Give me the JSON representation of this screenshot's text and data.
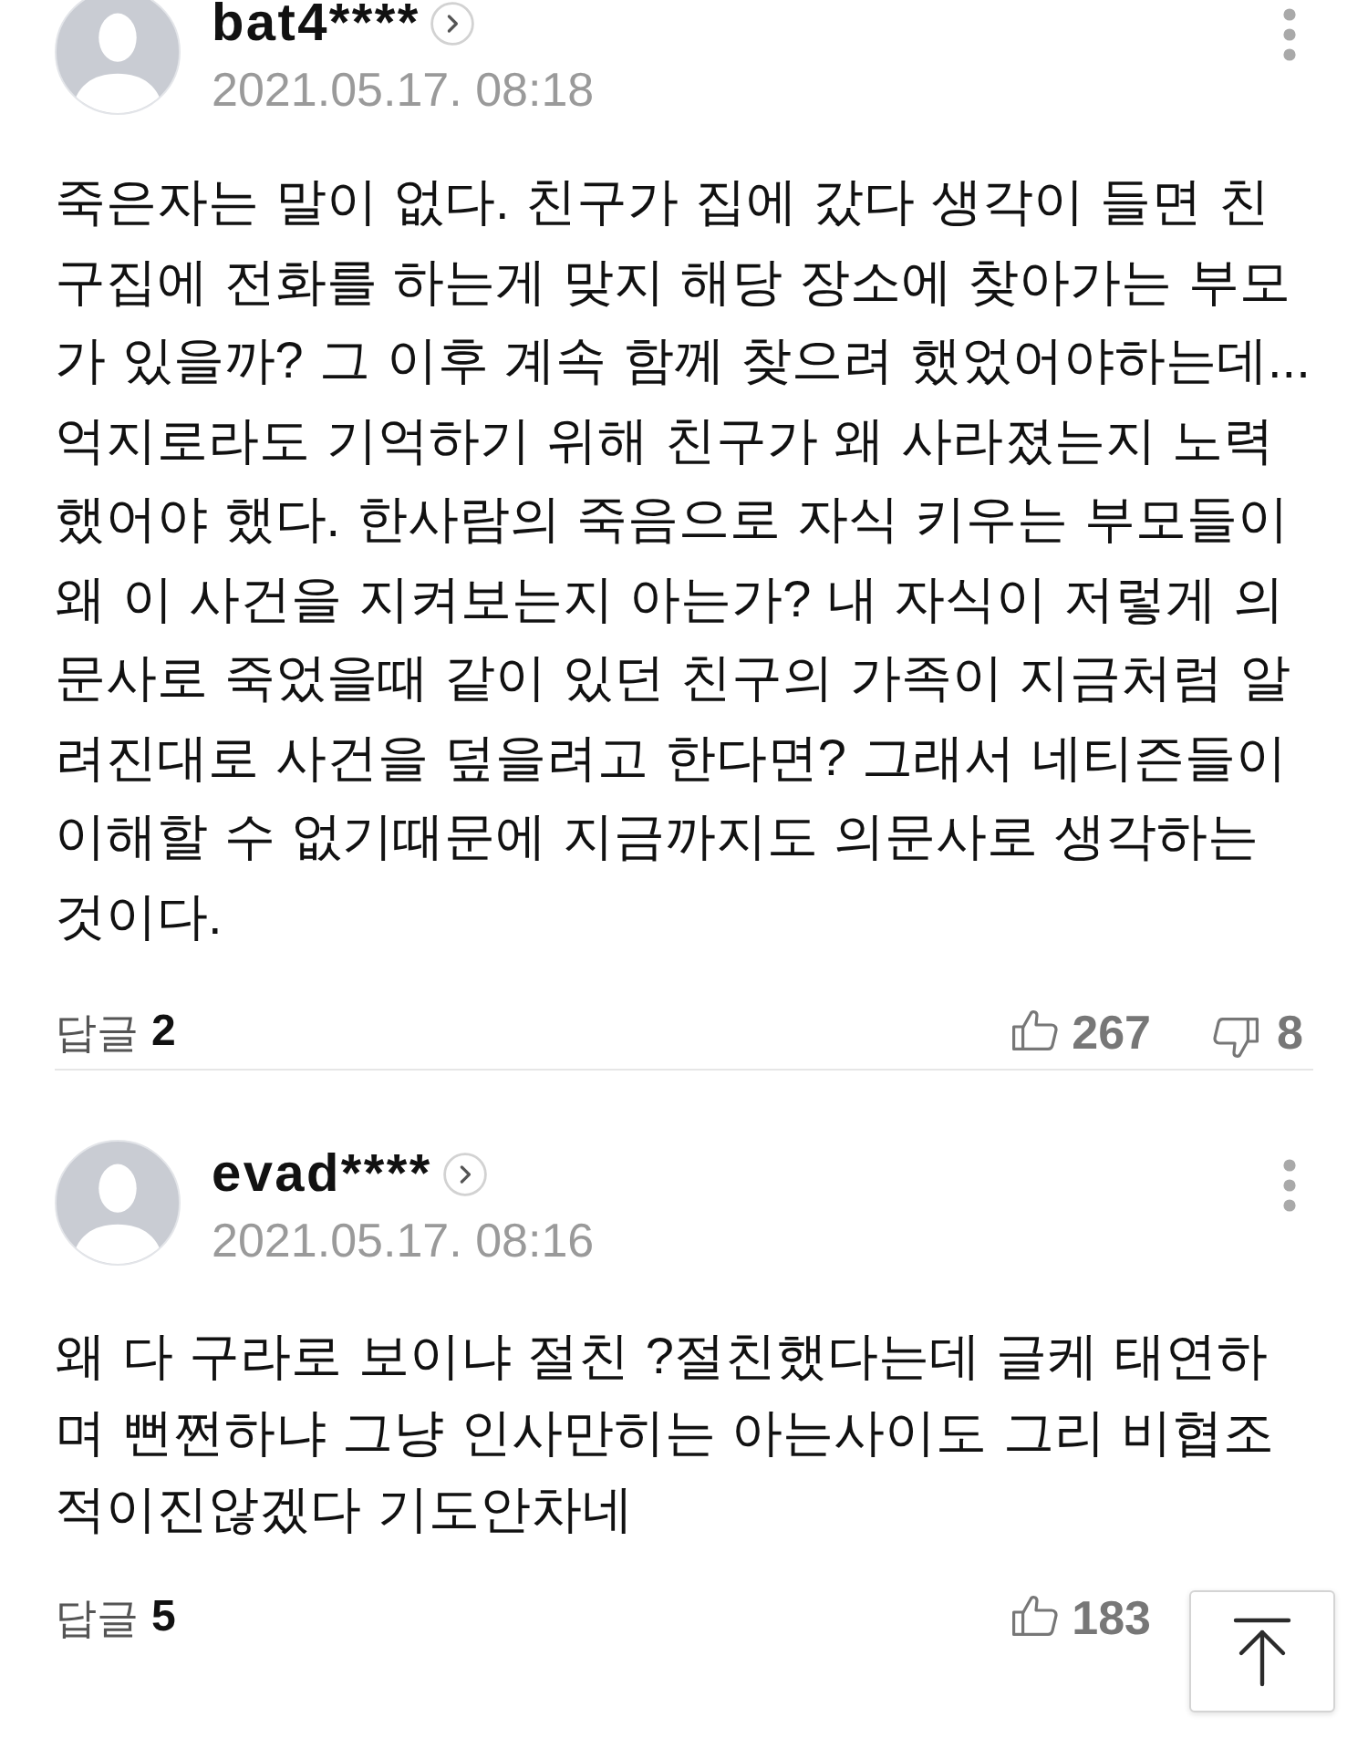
{
  "comments": [
    {
      "author": "bat4****",
      "date": "2021.05.17. 08:18",
      "text": "죽은자는 말이 없다. 친구가 집에 갔다 생각이 들면 친구집에 전화를 하는게 맞지 해당 장소에 찾아가는 부모가 있을까? 그 이후 계속 함께 찾으려 했었어야하는데...억지로라도 기억하기 위해 친구가 왜 사라졌는지 노력했어야 했다. 한사람의 죽음으로 자식 키우는 부모들이 왜 이 사건을 지켜보는지 아는가? 내 자식이 저렇게 의문사로 죽었을때 같이 있던 친구의 가족이 지금처럼 알려진대로 사건을 덮을려고 한다면? 그래서 네티즌들이 이해할 수 없기때문에 지금까지도 의문사로 생각하는 것이다.",
      "reply": {
        "label": "답글",
        "count": "2"
      },
      "likes": "267",
      "dislikes": "8"
    },
    {
      "author": "evad****",
      "date": "2021.05.17. 08:16",
      "text": "왜 다 구라로 보이냐 절친 ?절친했다는데 글케 태연하며 뻔쩐하냐 그냥 인사만히는 아는사이도 그리 비협조적이진않겠다 기도안차네",
      "reply": {
        "label": "답글",
        "count": "5"
      },
      "likes": "183"
    }
  ],
  "scroll_to_top_button": true
}
